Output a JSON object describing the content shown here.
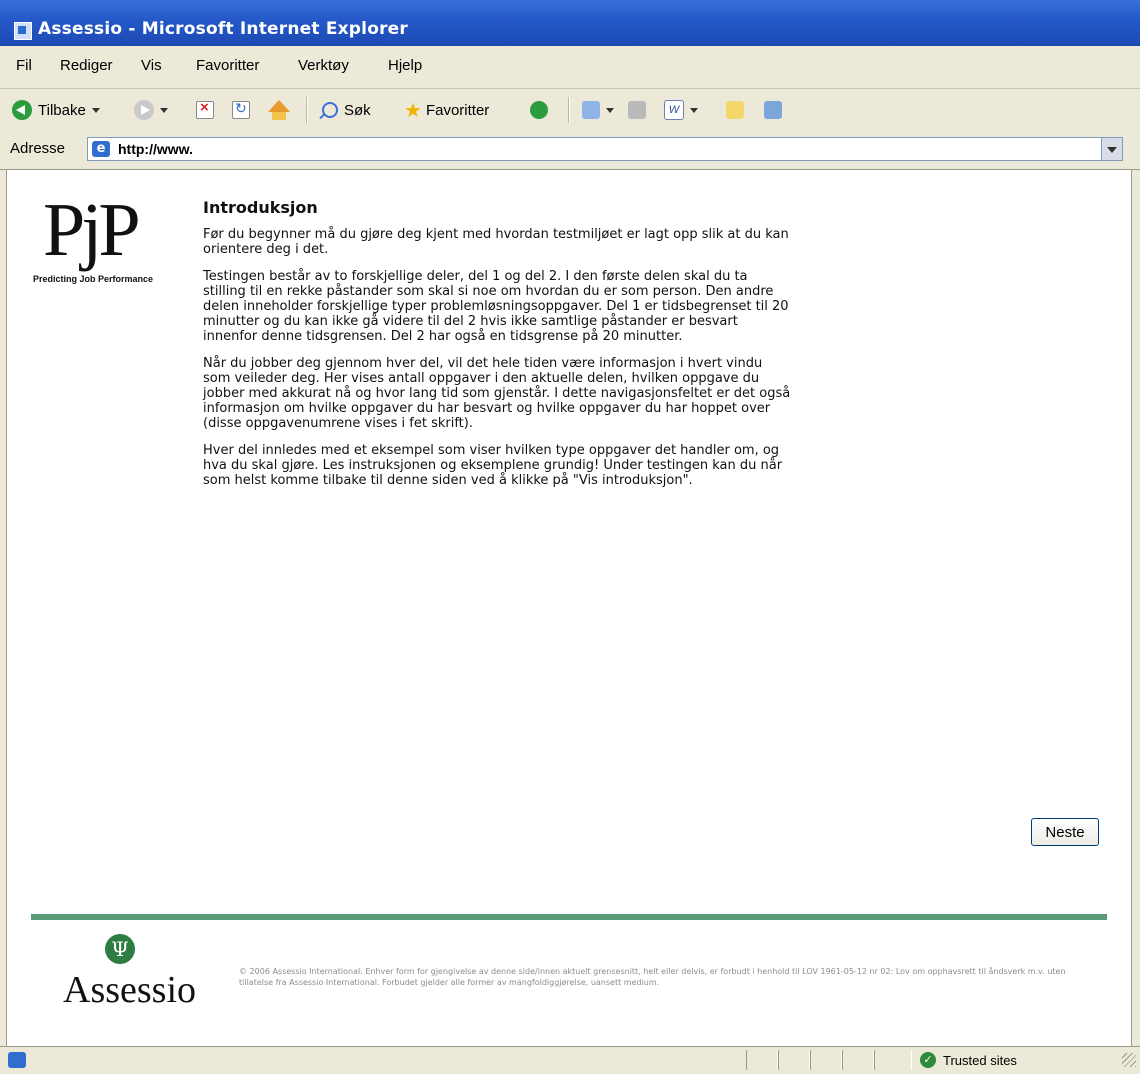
{
  "window": {
    "title": "Assessio - Microsoft Internet Explorer"
  },
  "menu": {
    "items": [
      "Fil",
      "Rediger",
      "Vis",
      "Favoritter",
      "Verktøy",
      "Hjelp"
    ]
  },
  "toolbar": {
    "back_label": "Tilbake",
    "search_label": "Søk",
    "favorites_label": "Favoritter"
  },
  "address": {
    "label": "Adresse",
    "url": "http://www."
  },
  "page": {
    "logo_tagline": "Predicting Job Performance",
    "logo_mark": "PjP",
    "heading": "Introduksjon",
    "paragraphs": [
      "Før du begynner må du gjøre deg kjent med hvordan testmiljøet er lagt opp slik at du kan orientere deg i det.",
      "Testingen består av to forskjellige deler, del 1 og del 2. I den første delen skal du ta stilling til en rekke påstander som skal si noe om hvordan du er som person. Den andre delen inneholder forskjellige typer problemløsningsoppgaver. Del 1 er tidsbegrenset til 20 minutter og du kan ikke gå videre til del 2 hvis ikke samtlige påstander er besvart innenfor denne tidsgrensen. Del 2 har også en tidsgrense på 20 minutter.",
      "Når du jobber deg gjennom hver del, vil det hele tiden være informasjon i hvert vindu som veileder deg. Her vises antall oppgaver i den aktuelle delen, hvilken oppgave du jobber med akkurat nå og hvor lang tid som gjenstår. I dette navigasjonsfeltet er det også informasjon om hvilke oppgaver du har besvart og hvilke oppgaver du har hoppet over (disse oppgavenumrene vises i fet skrift).",
      "Hver del innledes med et eksempel som viser hvilken type oppgaver det handler om, og hva du skal gjøre. Les instruksjonen og eksemplene grundig! Under testingen kan du når som helst komme tilbake til denne siden ved å klikke på \"Vis introduksjon\"."
    ],
    "next_button": "Neste",
    "footer_logo": "Assessio",
    "copyright": "© 2006 Assessio International. Enhver form for gjengivelse av denne side/innen aktuelt grensesnitt, helt eller delvis, er forbudt i henhold til LOV 1961-05-12 nr 02: Lov om opphavsrett til åndsverk m.v. uten tillatelse fra Assessio International. Forbudet gjelder alle former av mangfoldiggjørelse, uansett medium."
  },
  "status": {
    "zone": "Trusted sites"
  },
  "colors": {
    "titlebar": "#2457c8",
    "footer_rule": "#5a9c78",
    "assessio_green": "#2e7d45"
  }
}
